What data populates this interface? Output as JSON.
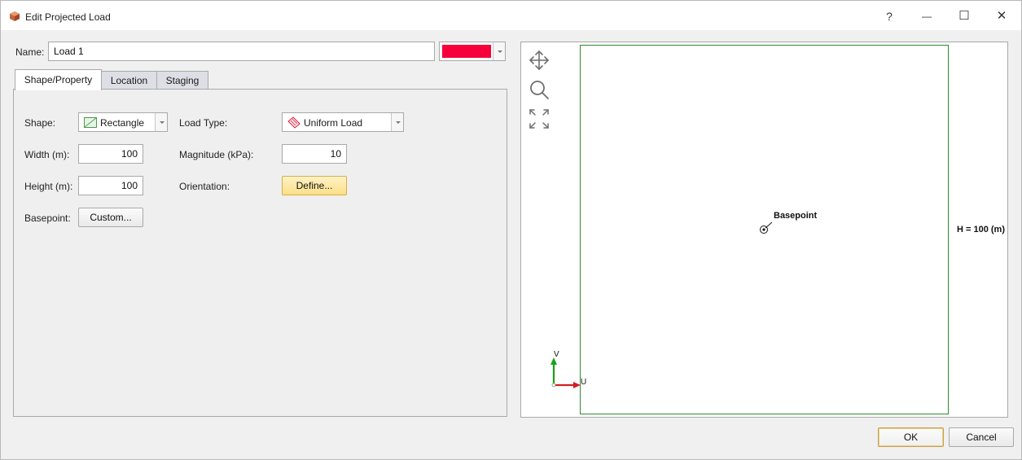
{
  "window": {
    "title": "Edit Projected Load",
    "help_glyph": "?",
    "minimize_glyph": "—",
    "maximize_glyph": "☐",
    "close_glyph": "✕"
  },
  "name_field": {
    "label": "Name:",
    "value": "Load 1"
  },
  "color_picker": {
    "color": "#f5003a"
  },
  "tabs": [
    {
      "label": "Shape/Property",
      "active": true
    },
    {
      "label": "Location",
      "active": false
    },
    {
      "label": "Staging",
      "active": false
    }
  ],
  "shape": {
    "label": "Shape:",
    "value": "Rectangle",
    "icon": "rectangle-shape-icon"
  },
  "load_type": {
    "label": "Load Type:",
    "value": "Uniform Load",
    "icon": "uniform-load-icon"
  },
  "width": {
    "label": "Width (m):",
    "value": "100"
  },
  "magnitude": {
    "label": "Magnitude (kPa):",
    "value": "10"
  },
  "height": {
    "label": "Height (m):",
    "value": "100"
  },
  "orientation": {
    "label": "Orientation:",
    "button": "Define..."
  },
  "basepoint": {
    "label": "Basepoint:",
    "button": "Custom..."
  },
  "preview": {
    "basepoint_label": "Basepoint",
    "dimension_label": "H = 100 (m)",
    "axis_v": "V",
    "axis_u": "U",
    "tools": [
      "pan-icon",
      "zoom-icon",
      "zoom-extents-icon"
    ],
    "outline_color": "#2e8b2e"
  },
  "footer": {
    "ok": "OK",
    "cancel": "Cancel"
  }
}
